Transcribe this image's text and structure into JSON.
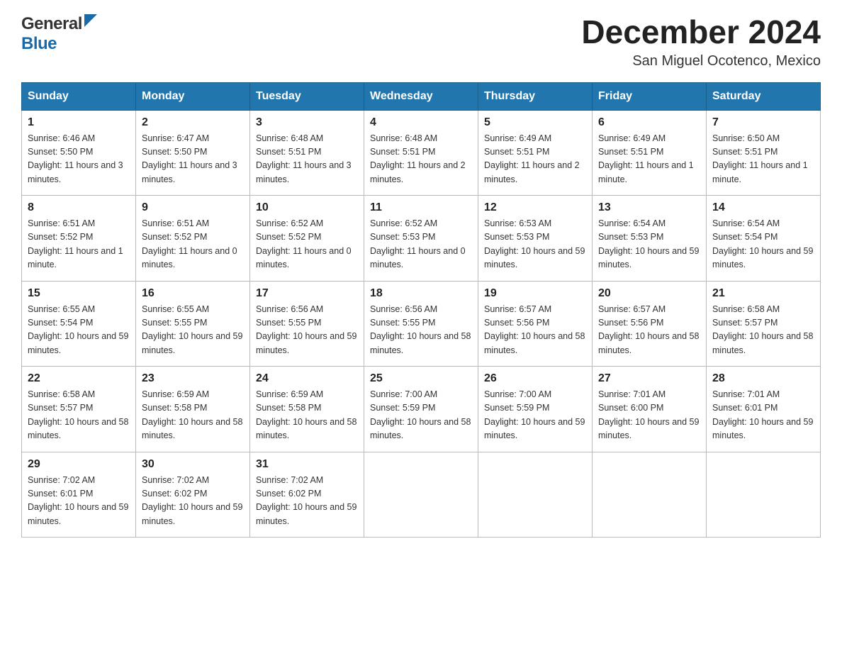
{
  "logo": {
    "general": "General",
    "blue": "Blue"
  },
  "title": "December 2024",
  "subtitle": "San Miguel Ocotenco, Mexico",
  "days": [
    "Sunday",
    "Monday",
    "Tuesday",
    "Wednesday",
    "Thursday",
    "Friday",
    "Saturday"
  ],
  "weeks": [
    [
      {
        "day": "1",
        "sunrise": "6:46 AM",
        "sunset": "5:50 PM",
        "daylight": "11 hours and 3 minutes."
      },
      {
        "day": "2",
        "sunrise": "6:47 AM",
        "sunset": "5:50 PM",
        "daylight": "11 hours and 3 minutes."
      },
      {
        "day": "3",
        "sunrise": "6:48 AM",
        "sunset": "5:51 PM",
        "daylight": "11 hours and 3 minutes."
      },
      {
        "day": "4",
        "sunrise": "6:48 AM",
        "sunset": "5:51 PM",
        "daylight": "11 hours and 2 minutes."
      },
      {
        "day": "5",
        "sunrise": "6:49 AM",
        "sunset": "5:51 PM",
        "daylight": "11 hours and 2 minutes."
      },
      {
        "day": "6",
        "sunrise": "6:49 AM",
        "sunset": "5:51 PM",
        "daylight": "11 hours and 1 minute."
      },
      {
        "day": "7",
        "sunrise": "6:50 AM",
        "sunset": "5:51 PM",
        "daylight": "11 hours and 1 minute."
      }
    ],
    [
      {
        "day": "8",
        "sunrise": "6:51 AM",
        "sunset": "5:52 PM",
        "daylight": "11 hours and 1 minute."
      },
      {
        "day": "9",
        "sunrise": "6:51 AM",
        "sunset": "5:52 PM",
        "daylight": "11 hours and 0 minutes."
      },
      {
        "day": "10",
        "sunrise": "6:52 AM",
        "sunset": "5:52 PM",
        "daylight": "11 hours and 0 minutes."
      },
      {
        "day": "11",
        "sunrise": "6:52 AM",
        "sunset": "5:53 PM",
        "daylight": "11 hours and 0 minutes."
      },
      {
        "day": "12",
        "sunrise": "6:53 AM",
        "sunset": "5:53 PM",
        "daylight": "10 hours and 59 minutes."
      },
      {
        "day": "13",
        "sunrise": "6:54 AM",
        "sunset": "5:53 PM",
        "daylight": "10 hours and 59 minutes."
      },
      {
        "day": "14",
        "sunrise": "6:54 AM",
        "sunset": "5:54 PM",
        "daylight": "10 hours and 59 minutes."
      }
    ],
    [
      {
        "day": "15",
        "sunrise": "6:55 AM",
        "sunset": "5:54 PM",
        "daylight": "10 hours and 59 minutes."
      },
      {
        "day": "16",
        "sunrise": "6:55 AM",
        "sunset": "5:55 PM",
        "daylight": "10 hours and 59 minutes."
      },
      {
        "day": "17",
        "sunrise": "6:56 AM",
        "sunset": "5:55 PM",
        "daylight": "10 hours and 59 minutes."
      },
      {
        "day": "18",
        "sunrise": "6:56 AM",
        "sunset": "5:55 PM",
        "daylight": "10 hours and 58 minutes."
      },
      {
        "day": "19",
        "sunrise": "6:57 AM",
        "sunset": "5:56 PM",
        "daylight": "10 hours and 58 minutes."
      },
      {
        "day": "20",
        "sunrise": "6:57 AM",
        "sunset": "5:56 PM",
        "daylight": "10 hours and 58 minutes."
      },
      {
        "day": "21",
        "sunrise": "6:58 AM",
        "sunset": "5:57 PM",
        "daylight": "10 hours and 58 minutes."
      }
    ],
    [
      {
        "day": "22",
        "sunrise": "6:58 AM",
        "sunset": "5:57 PM",
        "daylight": "10 hours and 58 minutes."
      },
      {
        "day": "23",
        "sunrise": "6:59 AM",
        "sunset": "5:58 PM",
        "daylight": "10 hours and 58 minutes."
      },
      {
        "day": "24",
        "sunrise": "6:59 AM",
        "sunset": "5:58 PM",
        "daylight": "10 hours and 58 minutes."
      },
      {
        "day": "25",
        "sunrise": "7:00 AM",
        "sunset": "5:59 PM",
        "daylight": "10 hours and 58 minutes."
      },
      {
        "day": "26",
        "sunrise": "7:00 AM",
        "sunset": "5:59 PM",
        "daylight": "10 hours and 59 minutes."
      },
      {
        "day": "27",
        "sunrise": "7:01 AM",
        "sunset": "6:00 PM",
        "daylight": "10 hours and 59 minutes."
      },
      {
        "day": "28",
        "sunrise": "7:01 AM",
        "sunset": "6:01 PM",
        "daylight": "10 hours and 59 minutes."
      }
    ],
    [
      {
        "day": "29",
        "sunrise": "7:02 AM",
        "sunset": "6:01 PM",
        "daylight": "10 hours and 59 minutes."
      },
      {
        "day": "30",
        "sunrise": "7:02 AM",
        "sunset": "6:02 PM",
        "daylight": "10 hours and 59 minutes."
      },
      {
        "day": "31",
        "sunrise": "7:02 AM",
        "sunset": "6:02 PM",
        "daylight": "10 hours and 59 minutes."
      },
      null,
      null,
      null,
      null
    ]
  ]
}
